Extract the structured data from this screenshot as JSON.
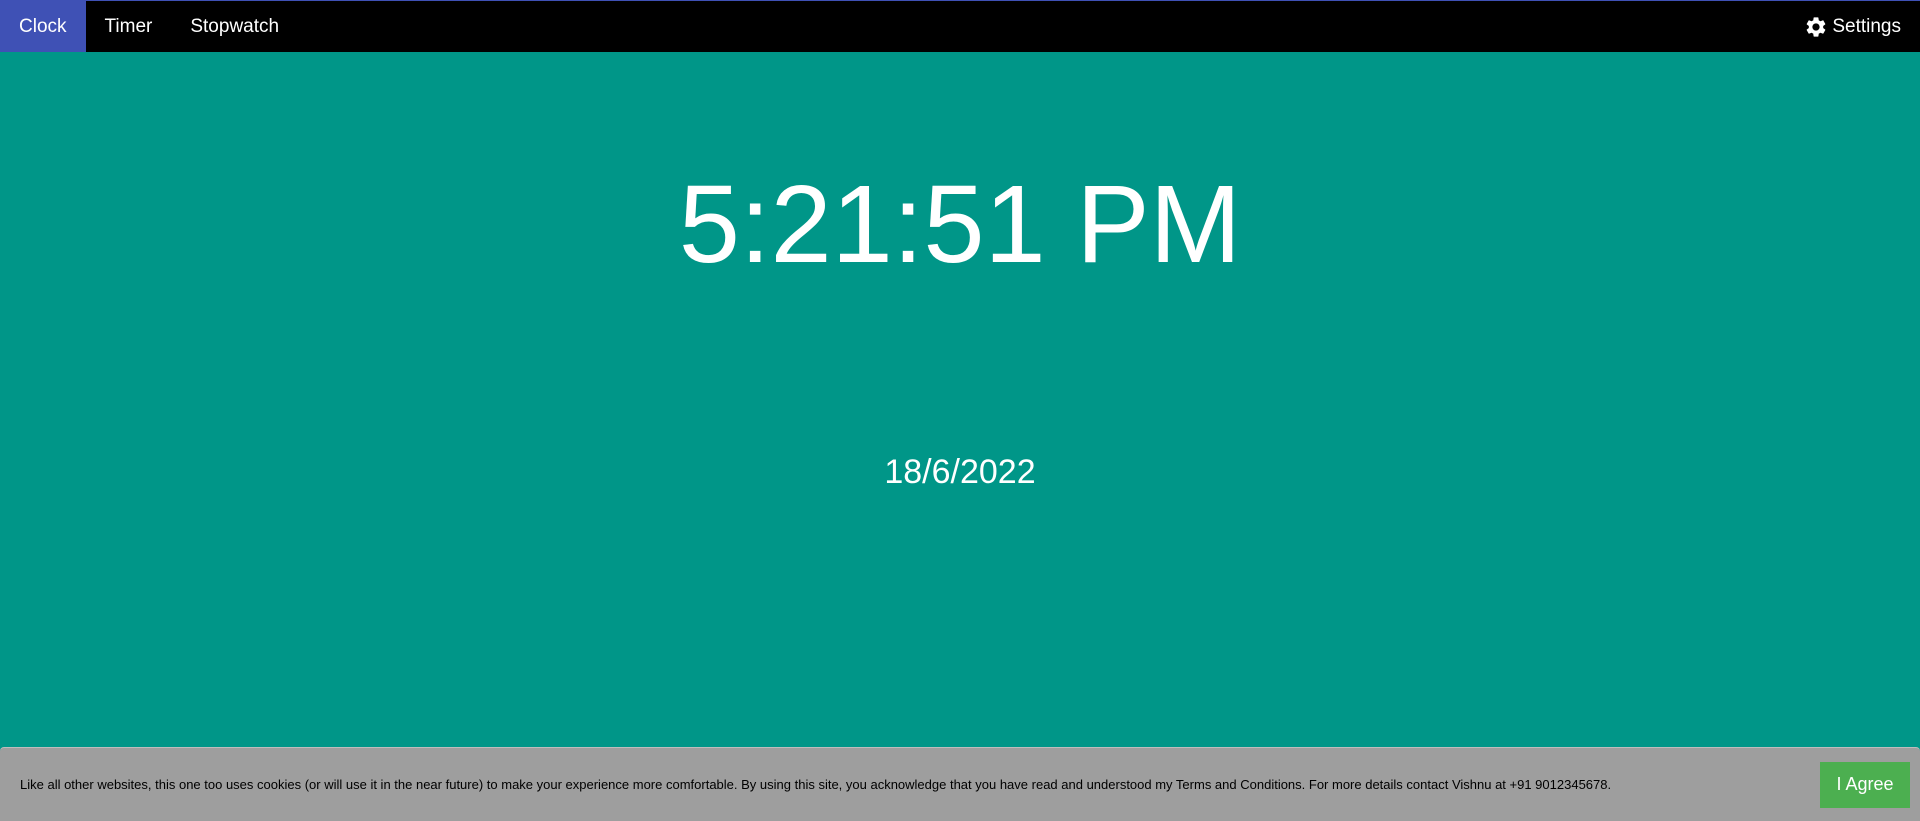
{
  "nav": {
    "tabs": [
      {
        "label": "Clock",
        "active": true
      },
      {
        "label": "Timer",
        "active": false
      },
      {
        "label": "Stopwatch",
        "active": false
      }
    ],
    "settings_label": "Settings",
    "settings_icon": "gear-icon"
  },
  "clock": {
    "time": "5:21:51 PM",
    "date": "18/6/2022"
  },
  "cookie": {
    "message": "Like all other websites, this one too uses cookies (or will use it in the near future) to make your experience more comfortable. By using this site, you acknowledge that you have read and understood my Terms and Conditions. For more details contact Vishnu at +91 9012345678.",
    "agree_label": "I Agree"
  },
  "colors": {
    "background": "#009688",
    "navbar": "#000000",
    "active_tab": "#3f51b5",
    "banner": "#9e9e9e",
    "agree_button": "#4caf50"
  }
}
